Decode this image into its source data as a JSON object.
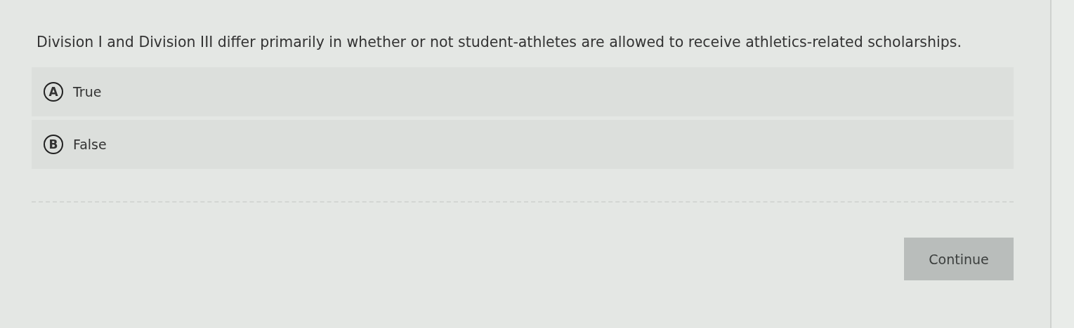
{
  "question": "Division I and Division III differ primarily in whether or not student-athletes are allowed to receive athletics-related scholarships.",
  "options": [
    {
      "letter": "A",
      "label": "True",
      "selected": false
    },
    {
      "letter": "B",
      "label": "False",
      "selected": false
    }
  ],
  "continue_button": {
    "label": "Continue",
    "disabled": true
  }
}
